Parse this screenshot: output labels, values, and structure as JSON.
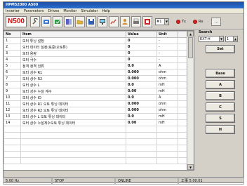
{
  "window": {
    "title": "HPM52000 A500"
  },
  "menu": [
    "Inverter",
    "Parameters",
    "Drives",
    "Monitor",
    "Simulator",
    "Help"
  ],
  "toolbar": {
    "model": "N500",
    "port_value": "#1",
    "tx_label": "Tx",
    "rx_label": "Rx",
    "more_label": "..."
  },
  "table": {
    "headers": {
      "no": "No",
      "item": "Item",
      "value": "Value",
      "unit": "Unit"
    },
    "rows": [
      {
        "no": "1",
        "item": "모터 튜닝 설정",
        "value": "0",
        "unit": "-"
      },
      {
        "no": "2",
        "item": "모터 데이터 설정(표준/오토튜)",
        "value": "0",
        "unit": "-"
      },
      {
        "no": "3",
        "item": "모터 용량",
        "value": "0",
        "unit": "-"
      },
      {
        "no": "4",
        "item": "모터 극수",
        "value": "0",
        "unit": "-"
      },
      {
        "no": "5",
        "item": "정격 정격 전류",
        "value": "0.0",
        "unit": "A"
      },
      {
        "no": "6",
        "item": "모터 상수 R1",
        "value": "0.000",
        "unit": "ohm"
      },
      {
        "no": "7",
        "item": "모터 상수 R2",
        "value": "0.000",
        "unit": "ohm"
      },
      {
        "no": "8",
        "item": "모터 상수 L",
        "value": "0.0",
        "unit": "mH"
      },
      {
        "no": "9",
        "item": "모터 상수 누설 계수",
        "value": "0.00",
        "unit": "mH"
      },
      {
        "no": "10",
        "item": "모터 상수 IO",
        "value": "0.0",
        "unit": "A"
      },
      {
        "no": "11",
        "item": "모터 상수 R1 오토 튜닝 데이터",
        "value": "0.000",
        "unit": "ohm"
      },
      {
        "no": "12",
        "item": "모터 상수 R2 오토 튜닝 데이터",
        "value": "0.000",
        "unit": "ohm"
      },
      {
        "no": "13",
        "item": "모터 상수 L 오토 튜닝 데이터",
        "value": "0.0",
        "unit": "mH"
      },
      {
        "no": "14",
        "item": "모터 상수 누설계수오토 튜닝 데이터",
        "value": "0.00",
        "unit": "mH"
      }
    ]
  },
  "search": {
    "title": "Search",
    "group_value": "EXT-H",
    "number_value": "1",
    "set_label": "Set"
  },
  "groups": [
    "Base",
    "A",
    "B",
    "C",
    "S",
    "H"
  ],
  "status": [
    "5.00 Hz",
    "STOP",
    "ONLINE",
    "工事 5.00.01"
  ]
}
